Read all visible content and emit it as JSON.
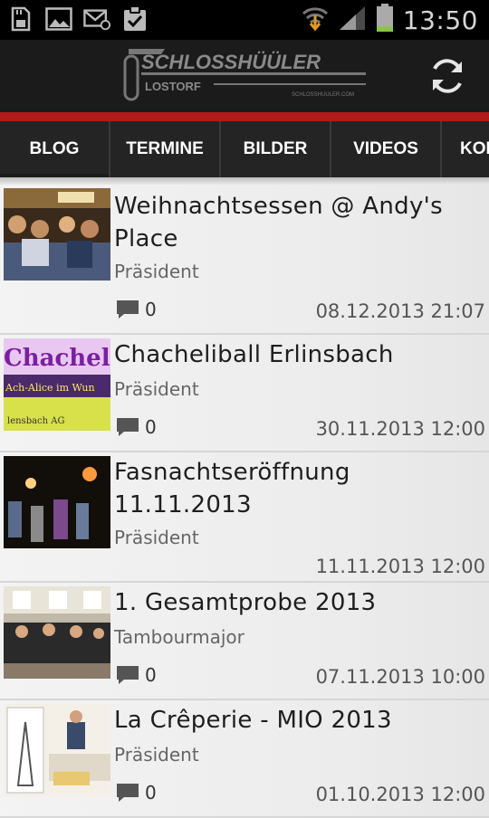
{
  "status_bar": {
    "time": "13:50",
    "icons": [
      "sd-card-icon",
      "gallery-icon",
      "missed-mail-icon",
      "task-check-icon",
      "wifi-download-icon",
      "signal-icon",
      "battery-icon"
    ]
  },
  "app": {
    "logo_text": "SCHLOSSHÜÜLER",
    "logo_subtext": "LOSTORF",
    "logo_url_text": "SCHLOSSHUULER.COM"
  },
  "tabs": [
    "BLOG",
    "TERMINE",
    "BILDER",
    "VIDEOS",
    "KON"
  ],
  "colors": {
    "accent_red": "#b31b1b",
    "appbar": "#1b1b1b",
    "tabbar": "#242424"
  },
  "posts": [
    {
      "title": "Weihnachtsessen @ Andy's Place",
      "author": "Präsident",
      "comments": "0",
      "date": "08.12.2013 21:07"
    },
    {
      "title": "Chacheliball Erlinsbach",
      "author": "Präsident",
      "comments": "0",
      "date": "30.11.2013 12:00",
      "thumb_text": "Chacheli",
      "thumb_text2": "Ach-Alice im Wun",
      "thumb_text3": "lensbach AG"
    },
    {
      "title": "Fasnachtseröffnung 11.11.2013",
      "author": "Präsident",
      "comments": "",
      "date": "11.11.2013 12:00"
    },
    {
      "title": "1. Gesamtprobe 2013",
      "author": "Tambourmajor",
      "comments": "0",
      "date": "07.11.2013 10:00"
    },
    {
      "title": "La Crêperie - MIO 2013",
      "author": "Präsident",
      "comments": "0",
      "date": "01.10.2013 12:00"
    }
  ]
}
